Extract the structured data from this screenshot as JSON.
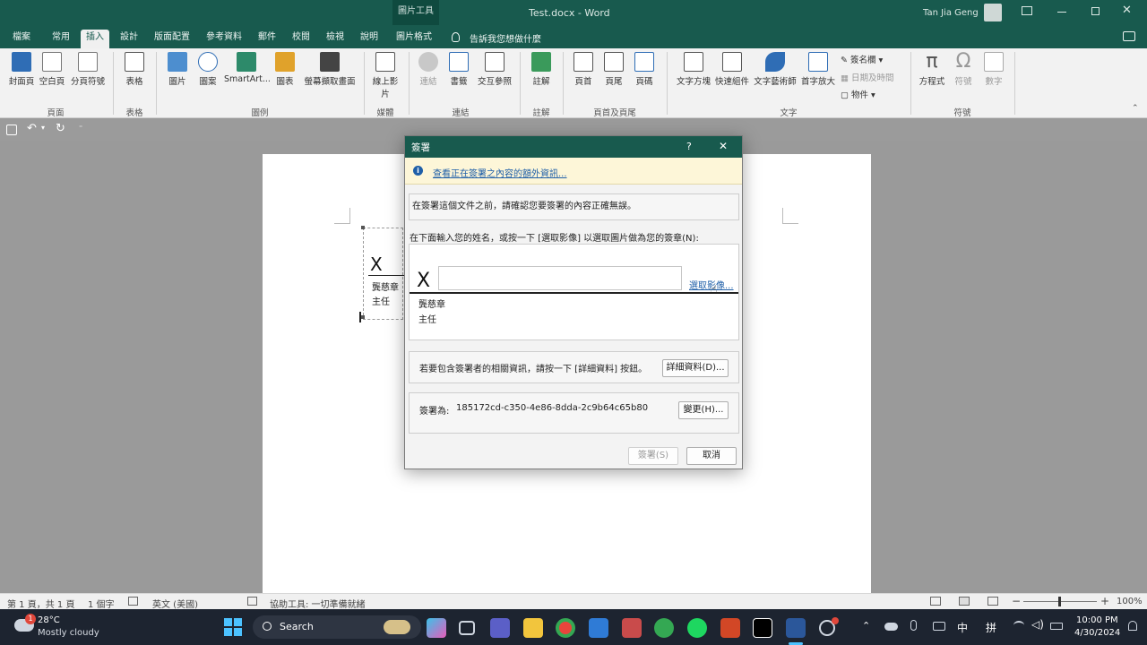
{
  "window": {
    "picture_tools": "圖片工具",
    "title": "Test.docx  -  Word",
    "user": "Tan Jia Geng"
  },
  "tabs": [
    "檔案",
    "常用",
    "插入",
    "設計",
    "版面配置",
    "參考資料",
    "郵件",
    "校閱",
    "檢視",
    "說明",
    "圖片格式"
  ],
  "tell_me": "告訴我您想做什麼",
  "ribbon": {
    "buttons": [
      "封面頁",
      "空白頁",
      "分頁符號",
      "表格",
      "圖片",
      "圖案",
      "SmartArt...",
      "圖表",
      "螢幕擷取畫面",
      "線上影片",
      "連結",
      "書籤",
      "交互參照",
      "註解",
      "頁首",
      "頁尾",
      "頁碼",
      "文字方塊",
      "快速組件",
      "文字藝術師",
      "首字放大",
      "方程式",
      "符號",
      "數字"
    ],
    "small_buttons": [
      "簽名欄",
      "日期及時間",
      "物件"
    ],
    "groups": [
      "頁面",
      "表格",
      "圖例",
      "媒體",
      "連結",
      "註解",
      "頁首及頁尾",
      "文字",
      "符號"
    ]
  },
  "document": {
    "sig_x": "X",
    "signer_name": "龔慈章",
    "signer_title": "主任"
  },
  "dialog": {
    "title": "簽署",
    "help": "?",
    "close": "✕",
    "info_link": "查看正在簽署之內容的額外資訊...",
    "confirm_text": "在簽署這個文件之前，請確認您要簽署的內容正確無誤。",
    "instruction": "在下面輸入您的姓名，或按一下 [選取影像] 以選取圖片做為您的簽章(N):",
    "sig_x": "X",
    "name_value": "",
    "select_image_link": "選取影像...",
    "signer_name": "龔慈章",
    "signer_title": "主任",
    "details_text": "若要包含簽署者的相關資訊，請按一下 [詳細資料] 按鈕。",
    "details_button": "詳細資料(D)...",
    "signing_as_label": "簽署為:",
    "signing_as_value": "185172cd-c350-4e86-8dda-2c9b64c65b80",
    "change_button": "變更(H)...",
    "sign_button": "簽署(S)",
    "cancel_button": "取消"
  },
  "status_bar": {
    "page": "第 1 頁，共 1 頁",
    "words": "1 個字",
    "language": "英文 (美國)",
    "accessibility": "協助工具: 一切準備就緒",
    "zoom": "100%"
  },
  "taskbar": {
    "temperature": "28°C",
    "weather": "Mostly cloudy",
    "weather_badge": "1",
    "search": "Search",
    "ime_1": "中",
    "ime_2": "拼",
    "time": "10:00 PM",
    "date": "4/30/2024"
  },
  "colors": {
    "accent": "#185a4e",
    "link": "#1f5fa8",
    "taskbar": "#1d2430"
  }
}
